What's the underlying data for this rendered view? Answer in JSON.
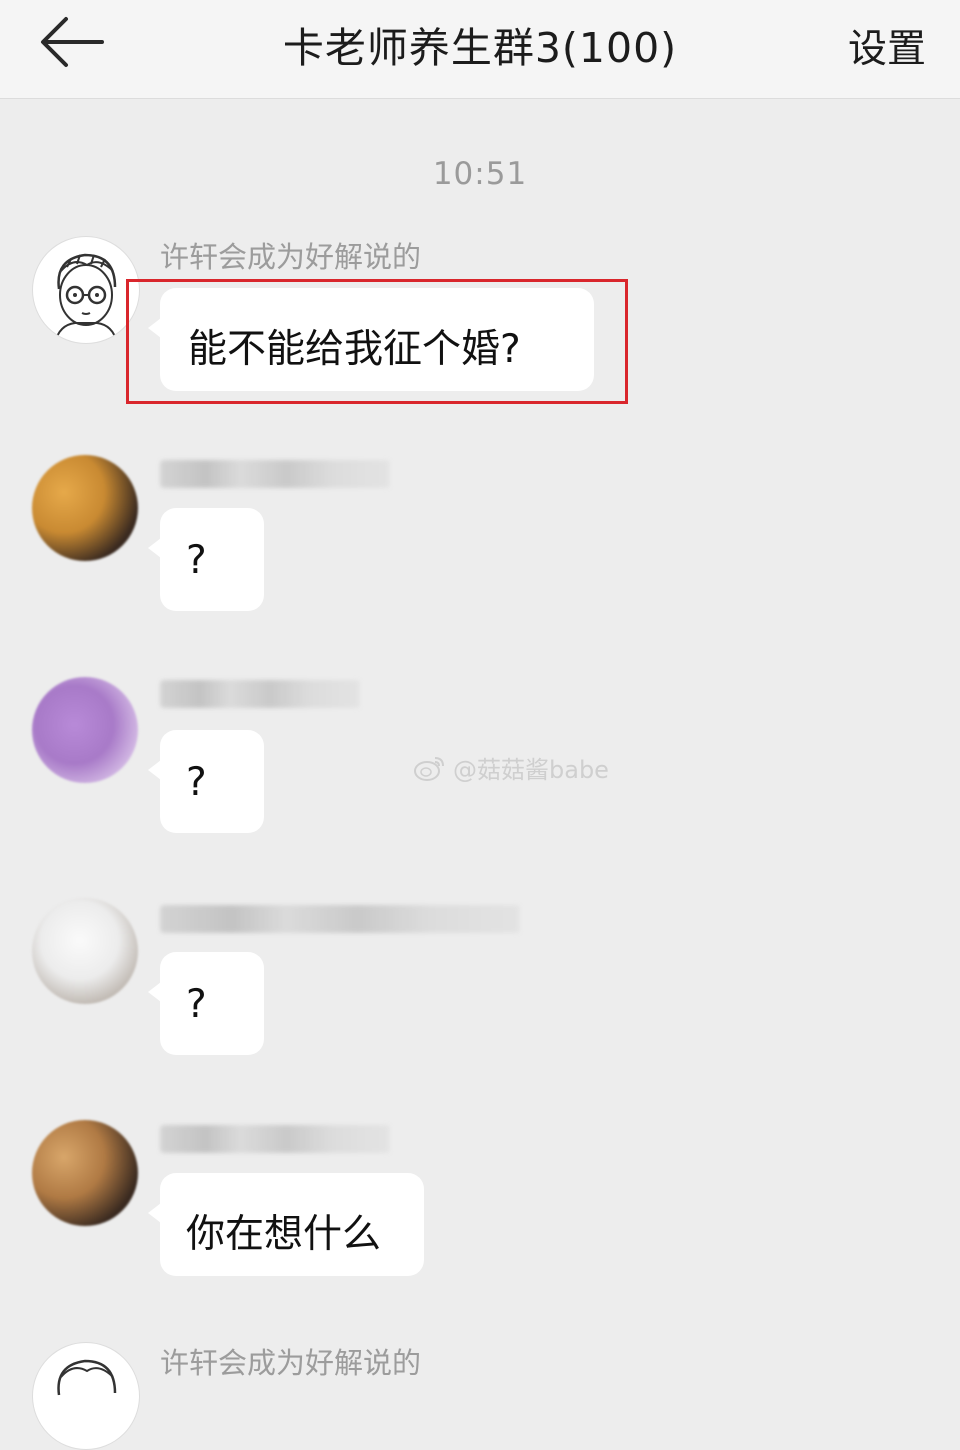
{
  "header": {
    "title": "卡老师养生群3(100)",
    "settings_label": "设置"
  },
  "time_label": "10:51",
  "messages": [
    {
      "sender": "许轩会成为好解说的",
      "text": "能不能给我征个婚?"
    },
    {
      "sender": "",
      "text": "?"
    },
    {
      "sender": "",
      "text": "?"
    },
    {
      "sender": "",
      "text": "?"
    },
    {
      "sender": "",
      "text": "你在想什么"
    },
    {
      "sender": "许轩会成为好解说的",
      "text": ""
    }
  ],
  "watermark": "@菇菇酱babe",
  "colors": {
    "background": "#ededed",
    "bubble": "#ffffff",
    "highlight_border": "#d9262c"
  },
  "icons": [
    "back-arrow-icon",
    "weibo-icon"
  ]
}
